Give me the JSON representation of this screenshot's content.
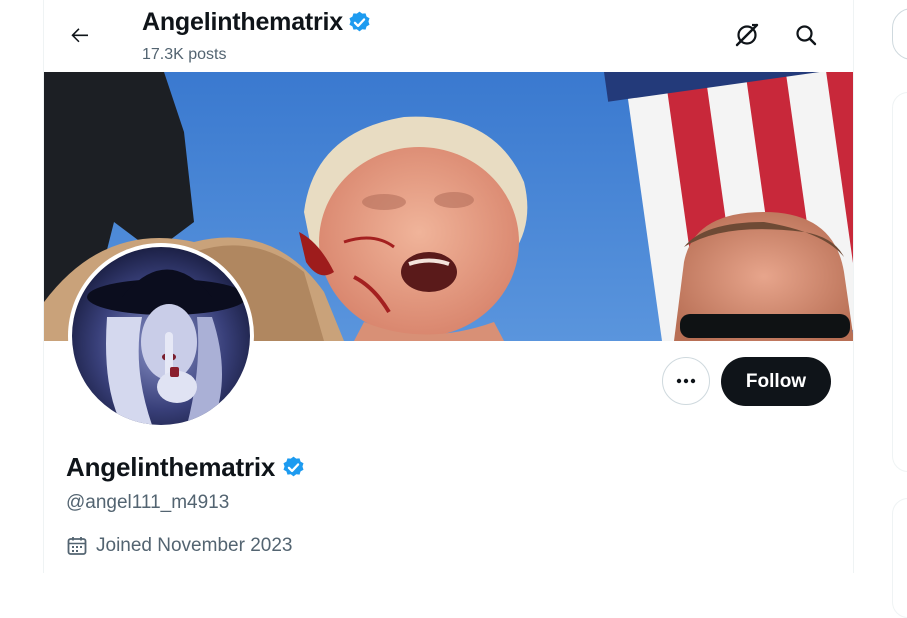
{
  "header": {
    "title": "Angelinthematrix",
    "posts": "17.3K posts"
  },
  "profile": {
    "display_name": "Angelinthematrix",
    "handle": "@angel111_m4913",
    "joined": "Joined November 2023",
    "follow_label": "Follow"
  },
  "icons": {
    "back": "back-arrow-icon",
    "grok": "grok-icon",
    "search": "search-icon",
    "verified": "verified-badge-icon",
    "more": "more-icon",
    "calendar": "calendar-icon"
  },
  "colors": {
    "verified": "#1d9bf0",
    "follow_bg": "#0f1419",
    "muted_text": "#536471",
    "banner_sky": "#3f7fd0"
  }
}
